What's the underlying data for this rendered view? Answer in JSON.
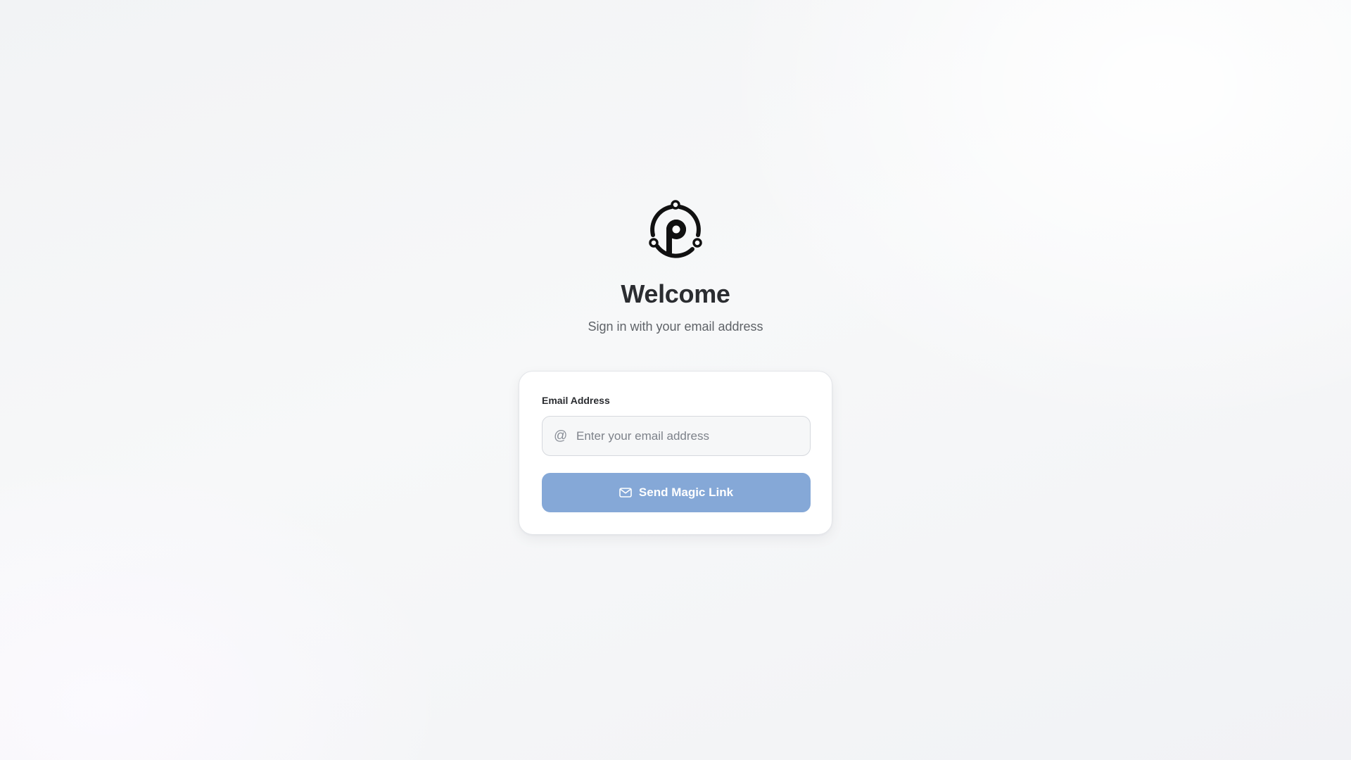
{
  "branding": {
    "logo_icon": "p-orbit-logo-icon",
    "title": "Welcome",
    "subtitle": "Sign in with your email address"
  },
  "form": {
    "email_label": "Email Address",
    "email_icon": "at-icon",
    "email_icon_glyph": "@",
    "email_placeholder": "Enter your email address",
    "email_value": "",
    "submit_label": "Send Magic Link",
    "submit_icon": "mail-icon",
    "submit_disabled": true
  },
  "colors": {
    "button_background": "#85a8d7",
    "title_text": "#2b2d31",
    "subtitle_text": "#5f6368"
  }
}
